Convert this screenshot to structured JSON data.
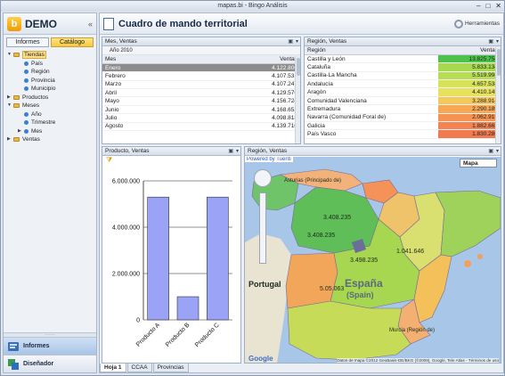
{
  "window": {
    "title": "mapas.bi - Bingo Análisis",
    "minimize": "–",
    "maximize": "□",
    "close": "✕"
  },
  "brand": {
    "logo": "b",
    "name": "DEMO",
    "collapse": "«"
  },
  "left_tabs": [
    {
      "label": "Informes"
    },
    {
      "label": "Catálogo"
    }
  ],
  "tree": [
    {
      "label": "Tiendas",
      "arrow": "▼",
      "kind": "folder",
      "selected": true
    },
    {
      "label": "País",
      "kind": "item"
    },
    {
      "label": "Región",
      "kind": "item"
    },
    {
      "label": "Provincia",
      "kind": "item"
    },
    {
      "label": "Municipio",
      "kind": "item"
    },
    {
      "label": "Productos",
      "arrow": "▶",
      "kind": "folder"
    },
    {
      "label": "Meses",
      "arrow": "▼",
      "kind": "folder"
    },
    {
      "label": "Año",
      "kind": "item"
    },
    {
      "label": "Trimestre",
      "kind": "item"
    },
    {
      "label": "Mes",
      "arrow": "▶",
      "kind": "item"
    },
    {
      "label": "Ventas",
      "arrow": "▶",
      "kind": "folder"
    }
  ],
  "nav": {
    "grip": "·······",
    "informes": "Informes",
    "disenador": "Diseñador"
  },
  "main": {
    "title": "Cuadro de mando territorial",
    "tools": "Herramientas"
  },
  "panel_btns": {
    "menu": "▾",
    "max": "▣",
    "close": "✕"
  },
  "mes_ventas": {
    "title": "Mes, Ventas",
    "year": "Año 2010",
    "col_mes": "Mes",
    "col_ventas": "Ventas",
    "rows": [
      {
        "mes": "Enero",
        "ventas": "4.122.800",
        "selected": true
      },
      {
        "mes": "Febrero",
        "ventas": "4.107.531"
      },
      {
        "mes": "Marzo",
        "ventas": "4.107.247"
      },
      {
        "mes": "Abril",
        "ventas": "4.129.576"
      },
      {
        "mes": "Mayo",
        "ventas": "4.156.724"
      },
      {
        "mes": "Junio",
        "ventas": "4.168.653"
      },
      {
        "mes": "Julio",
        "ventas": "4.098.818"
      },
      {
        "mes": "Agosto",
        "ventas": "4.139.710"
      }
    ]
  },
  "region_ventas": {
    "title": "Región, Ventas",
    "col_region": "Región",
    "col_ventas": "Ventas",
    "rows": [
      {
        "region": "Castilla y León",
        "ventas": "13.825.754",
        "color": "#4cc24a"
      },
      {
        "region": "Cataluña",
        "ventas": "5.833.134",
        "color": "#a7d94e"
      },
      {
        "region": "Castilla-La Mancha",
        "ventas": "5.519.994",
        "color": "#b8dc52"
      },
      {
        "region": "Andalucía",
        "ventas": "4.657.538",
        "color": "#d6e25a"
      },
      {
        "region": "Aragón",
        "ventas": "4.410.145",
        "color": "#e8e15c"
      },
      {
        "region": "Comunidad Valenciana",
        "ventas": "3.288.914",
        "color": "#f5c85a"
      },
      {
        "region": "Extremadura",
        "ventas": "2.290.189",
        "color": "#f6a855"
      },
      {
        "region": "Navarra (Comunidad Foral de)",
        "ventas": "2.062.915",
        "color": "#f59452"
      },
      {
        "region": "Galicia",
        "ventas": "1.882.668",
        "color": "#f38350"
      },
      {
        "region": "País Vasco",
        "ventas": "1.830.286",
        "color": "#f17a4f"
      }
    ]
  },
  "producto_ventas": {
    "title": "Producto, Ventas",
    "filter": "⧩"
  },
  "chart_data": {
    "type": "bar",
    "categories": [
      "Producto A",
      "Producto B",
      "Producto C"
    ],
    "values": [
      5300000,
      1000000,
      5300000
    ],
    "yticks": [
      "0",
      "2.000.000",
      "4.000.000",
      "6.000.000"
    ],
    "ylim": [
      0,
      6000000
    ],
    "bar_color": "#9aa3f5",
    "title": "",
    "xlabel": "",
    "ylabel": ""
  },
  "map": {
    "title": "Región, Ventas",
    "powered": "Powered by Tuenti",
    "maptype": "Mapa",
    "labels": [
      {
        "text": "Asturias (Principado de)"
      },
      {
        "text": "3.408.235"
      },
      {
        "text": "3.408.235"
      },
      {
        "text": "3.498.235"
      },
      {
        "text": "1.041.646"
      },
      {
        "text": "5.05.063"
      },
      {
        "text": "Portugal"
      },
      {
        "text": "España"
      },
      {
        "text": "(Spain)"
      },
      {
        "text": "Murcia (Región de)"
      }
    ],
    "attribution": "Datos de mapa ©2012 GeoBasis-DE/BKG (©2009), Google, Tele Atlas - Términos de uso",
    "google": "Google"
  },
  "sheet_tabs": [
    {
      "label": "Hoja 1"
    },
    {
      "label": "CCAA"
    },
    {
      "label": "Provincias"
    }
  ]
}
